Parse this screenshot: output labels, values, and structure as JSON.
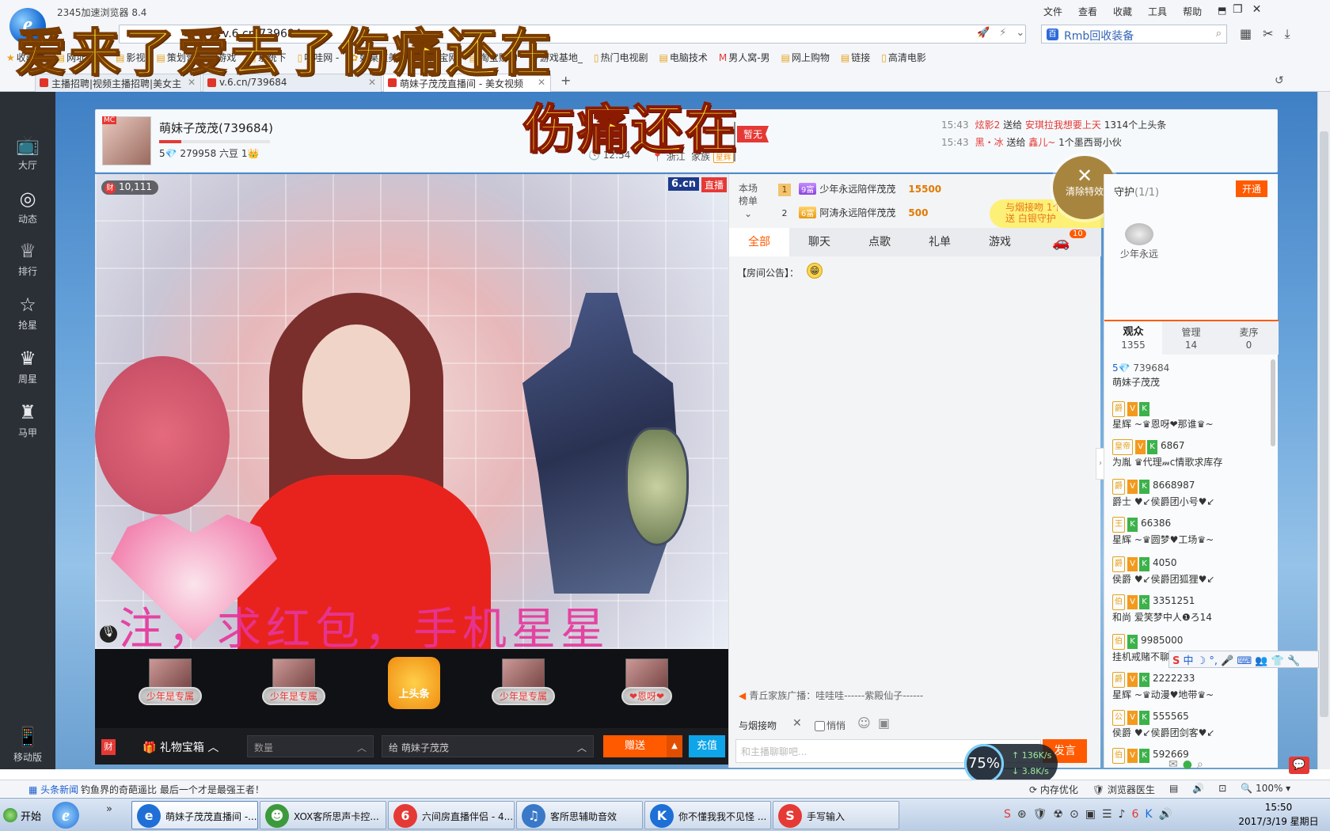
{
  "browser": {
    "app_title": "2345加速浏览器 8.4",
    "logo": "e",
    "menu": [
      "文件",
      "查看",
      "收藏",
      "工具",
      "帮助"
    ],
    "window_controls": [
      "–",
      "❐",
      "✕"
    ],
    "address": "v.6.cn/739684",
    "search_placeholder": "Rmb回收装备",
    "search_logo": "百",
    "bookmarks": [
      "收藏夹",
      "网址导航",
      "影视",
      "策划营",
      "游戏",
      "系统下",
      "哇哇网 -",
      "好桌道美化",
      "淘宝网",
      "淘宝购物",
      "游戏基地_",
      "热门电视剧",
      "电脑技术",
      "男人窝-男",
      "网上购物",
      "链接",
      "高清电影"
    ],
    "tabs": [
      "主播招聘|视频主播招聘|美女主",
      "v.6.cn/739684",
      "萌妹子茂茂直播间 - 美女视频"
    ],
    "new_tab": "+"
  },
  "overlay": {
    "lyric_top": "爱来了爱去了伤痛还在",
    "lyric_room": "伤痛还在"
  },
  "leftnav": [
    {
      "icon": "📺",
      "label": "大厅"
    },
    {
      "icon": "◎",
      "label": "动态"
    },
    {
      "icon": "♕",
      "label": "排行"
    },
    {
      "icon": "☆",
      "label": "抢星"
    },
    {
      "icon": "♛",
      "label": "周星"
    },
    {
      "icon": "♜",
      "label": "马甲"
    }
  ],
  "mobile_label": "移动版",
  "mobile_icon": "📱",
  "host": {
    "mc": "MC",
    "name": "萌妹子茂茂(739684)",
    "stats": "5💎 279958 六豆 1👑",
    "time": "🕓 12:54",
    "location": "📍 浙江",
    "family_label": "家族",
    "family_tag": "星辉",
    "zanwu": "暂无",
    "progress": 0.2
  },
  "notices": [
    {
      "time": "15:43",
      "sender": "炫影2",
      "verb": "送给",
      "receiver": "安琪拉我想要上天",
      "gift": "1314个上头条"
    },
    {
      "time": "15:43",
      "sender": "黑・冰",
      "verb": "送给",
      "receiver": "鑫儿~",
      "gift": "1个墨西哥小伙"
    }
  ],
  "video": {
    "viewers": "10,111",
    "viewers_icon": "财",
    "logo": "6.cn",
    "live": "直播",
    "caption": "注，求红包，手机星星",
    "mic": "🎙"
  },
  "gifts": [
    "少年是专属",
    "少年是专属",
    "上头条",
    "少年是专属",
    "❤恩呀❤"
  ],
  "gift_bar": {
    "cai": "财",
    "box": "🎁 礼物宝箱 ︿",
    "qty_placeholder": "数量",
    "qty_arrow": "︿",
    "to_prefix": "给",
    "to_name": "萌妹子茂茂",
    "to_arrow": "︿",
    "send": "赠送",
    "send_arrow": "▲",
    "recharge": "充值"
  },
  "rank": {
    "label": "本场\n榜单",
    "arrow": "⌄",
    "rows": [
      {
        "no": "1",
        "level": "9富",
        "name": "少年永远陪伴茂茂",
        "coins": "15500"
      },
      {
        "no": "2",
        "level": "6富",
        "name": "阿涛永远陪伴茂茂",
        "coins": "500"
      }
    ]
  },
  "clear_fx": {
    "x": "✕",
    "label": "清除特效"
  },
  "float_gift": {
    "line1": "与烟接吻  1个",
    "line2": "送 白银守护"
  },
  "chat": {
    "tabs": [
      "全部",
      "聊天",
      "点歌",
      "礼单",
      "游戏"
    ],
    "car_icon": "🚗",
    "car_count": "10",
    "announce": "【房间公告】：",
    "smiley": "😁",
    "broadcast_icon": "◀",
    "broadcast": "青丘家族广播：哇哇哇------紫殿仙子------",
    "target": "与烟接吻",
    "target_close": "✕",
    "whisper": "悄悄",
    "emoji": "☺",
    "image": "▣",
    "input_placeholder": "和主播聊聊吧...",
    "say": "发言"
  },
  "guard": {
    "title": "守护",
    "count": "(1/1)",
    "open": "开通",
    "user": "少年永远"
  },
  "audience_tabs": [
    {
      "label": "观众",
      "count": "1355"
    },
    {
      "label": "管理",
      "count": "14"
    },
    {
      "label": "麦序",
      "count": "0"
    }
  ],
  "audience": [
    {
      "badge": "5💎",
      "id": "739684",
      "name": "萌妹子茂茂"
    },
    {
      "badge": "爵",
      "id": "",
      "name": "星辉 ~♛恩呀❤那谁♛~"
    },
    {
      "badge": "皇帝",
      "id": "6867",
      "name": "为胤 ♛代理𝓂c情歌求库存"
    },
    {
      "badge": "爵",
      "id": "8668987",
      "name": "爵士 ♥↙侯爵团小号♥↙"
    },
    {
      "badge": "王",
      "id": "66386",
      "name": "星辉 ~♛圆梦♥工场♛~"
    },
    {
      "badge": "爵",
      "id": "4050",
      "name": "侯爵 ♥↙侯爵团狐狸♥↙"
    },
    {
      "badge": "伯",
      "id": "3351251",
      "name": "和尚 爱笑梦中人❶ろ14"
    },
    {
      "badge": "伯",
      "id": "9985000",
      "name": "挂机戒赌不聊"
    },
    {
      "badge": "爵",
      "id": "2222233",
      "name": "星辉 ~♛动漫♥地带♛~"
    },
    {
      "badge": "公",
      "id": "555565",
      "name": "侯爵 ♥↙侯爵团剑客♥↙"
    },
    {
      "badge": "伯",
      "id": "592669",
      "name": ""
    }
  ],
  "ime": {
    "logo": "S",
    "text": "中 ☽ °, 🎤 ⌨ 👥 👕 🔧"
  },
  "speed": {
    "percent": "75%",
    "up": "↑ 136K/s",
    "down": "↓ 3.8K/s"
  },
  "side_open": "›",
  "status": {
    "news_label": "▦ 头条新闻",
    "news_text": "钓鱼界的奇葩遥比 最后一个才是最强王者！",
    "right": [
      "⟳ 内存优化",
      "🛡 浏览器医生",
      "▤",
      "🔊",
      "⊡",
      "🔍 100% ▾"
    ],
    "msg": "💬"
  },
  "taskbar": {
    "start": "开始",
    "ie": "e",
    "more": "»",
    "tasks": [
      {
        "icon": "e",
        "color": "#1f6fd6",
        "label": "萌妹子茂茂直播间 -..."
      },
      {
        "icon": "☻",
        "color": "#3c9a3c",
        "label": "XOX客所思声卡控..."
      },
      {
        "icon": "6",
        "color": "#e53935",
        "label": "六间房直播伴侣 - 4...."
      },
      {
        "icon": "♫",
        "color": "#3a78c8",
        "label": "客所思辅助音效"
      },
      {
        "icon": "K",
        "color": "#1e6fd6",
        "label": "你不懂我我不见怪 ..."
      },
      {
        "icon": "S",
        "color": "#e53935",
        "label": "手写输入"
      }
    ],
    "tray": [
      "S",
      "⊛",
      "🛡",
      "☢",
      "⊙",
      "▣",
      "☰",
      "♪",
      "6",
      "K",
      "🔊"
    ],
    "time": "15:50",
    "date": "2017/3/19 星期日"
  }
}
